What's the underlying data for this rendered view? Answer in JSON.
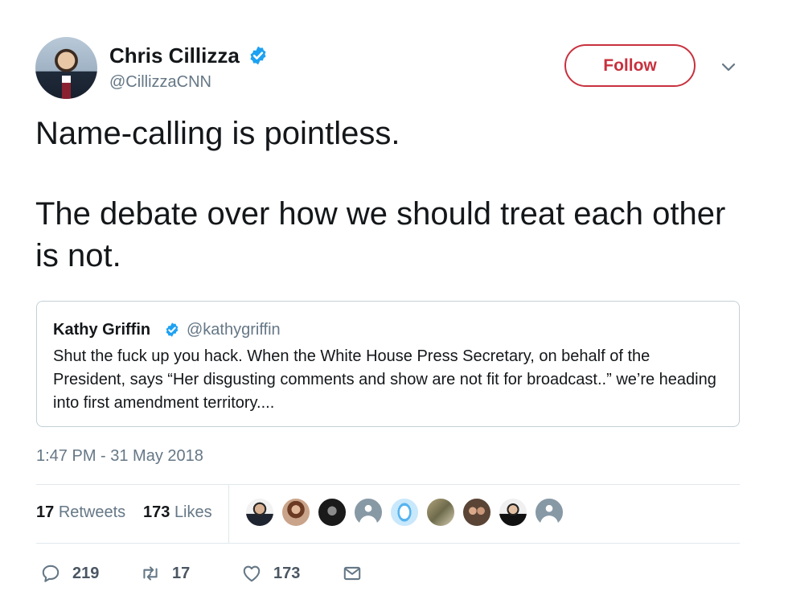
{
  "author": {
    "name": "Chris Cillizza",
    "handle": "@CillizzaCNN",
    "avatar_icon": "avatar-photo",
    "verified_icon": "verified-badge-icon"
  },
  "actions": {
    "follow_label": "Follow",
    "menu_icon": "chevron-down-icon"
  },
  "tweet": {
    "line1": "Name-calling is pointless.",
    "line2": "The debate over how we should treat each other is not."
  },
  "quote": {
    "name": "Kathy Griffin",
    "handle": "@kathygriffin",
    "text": "Shut the fuck up you hack. When the White House Press Secretary, on behalf of the President, says “Her disgusting comments and show are not fit for broadcast..” we’re heading into first amendment territory...."
  },
  "timestamp": "1:47 PM - 31 May 2018",
  "stats": {
    "retweets_count": "17",
    "retweets_label": "Retweets",
    "likes_count": "173",
    "likes_label": "Likes"
  },
  "likers_count_shown": 9,
  "footer": {
    "replies": "219",
    "retweets": "17",
    "likes": "173",
    "icons": [
      "reply-icon",
      "retweet-icon",
      "heart-icon",
      "mail-icon"
    ]
  },
  "colors": {
    "accent": "#c8313e",
    "verified": "#1da1f2",
    "secondary_text": "#657786",
    "border": "#e1e8ed"
  }
}
